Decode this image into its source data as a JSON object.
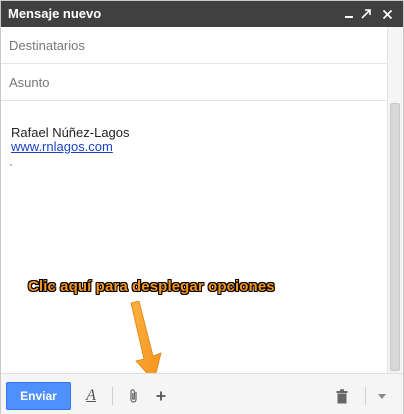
{
  "window": {
    "title": "Mensaje nuevo",
    "controls": [
      "minimize-icon",
      "expand-icon",
      "close-icon"
    ]
  },
  "compose": {
    "to_placeholder": "Destinatarios",
    "subject_placeholder": "Asunto",
    "signature_name": "Rafael Núñez-Lagos",
    "signature_link": "www.rnlagos.com"
  },
  "annotation": {
    "text": "Clic aquí para desplegar opciones",
    "color": "#f7941d"
  },
  "toolbar": {
    "send_label": "Enviar",
    "send_color": "#4d90fe",
    "format_icon": "A",
    "icons": [
      "format-text-icon",
      "attach-icon",
      "plus-icon",
      "trash-icon",
      "chevron-down-icon"
    ]
  }
}
